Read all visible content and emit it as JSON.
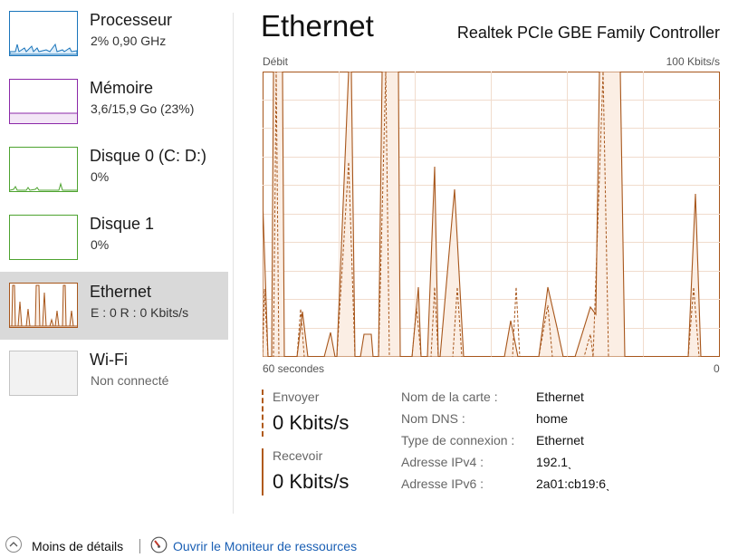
{
  "sidebar": {
    "items": [
      {
        "title": "Processeur",
        "subtitle": "2%  0,90 GHz",
        "color": "#1a75bb"
      },
      {
        "title": "Mémoire",
        "subtitle": "3,6/15,9 Go (23%)",
        "color": "#8b28a8"
      },
      {
        "title": "Disque 0 (C: D:)",
        "subtitle": "0%",
        "color": "#4da32f"
      },
      {
        "title": "Disque 1",
        "subtitle": "0%",
        "color": "#4da32f"
      },
      {
        "title": "Ethernet",
        "subtitle": "E : 0 R : 0 Kbits/s",
        "color": "#a7561b",
        "selected": true
      },
      {
        "title": "Wi-Fi",
        "subtitle": "Non connecté",
        "color": "#999999"
      }
    ]
  },
  "header": {
    "title": "Ethernet",
    "adapter": "Realtek PCIe GBE Family Controller"
  },
  "graph": {
    "top_left_label": "Débit",
    "top_right_label": "100 Kbits/s",
    "bottom_left_label": "60 secondes",
    "bottom_right_label": "0",
    "line_color": "#a7561b",
    "fill_color": "#fbeee4"
  },
  "stats": {
    "send_label": "Envoyer",
    "send_value": "0 Kbits/s",
    "receive_label": "Recevoir",
    "receive_value": "0 Kbits/s"
  },
  "properties": [
    {
      "key": "Nom de la carte :",
      "value": "Ethernet"
    },
    {
      "key": "Nom DNS :",
      "value": "home"
    },
    {
      "key": "Type de connexion :",
      "value": "Ethernet"
    },
    {
      "key": "Adresse IPv4 :",
      "value": "192.1ˎ"
    },
    {
      "key": "Adresse IPv6 :",
      "value": "2a01:cb19:6ˎ"
    }
  ],
  "footer": {
    "less_details": "Moins de détails",
    "open_monitor": "Ouvrir le Moniteur de ressources"
  }
}
